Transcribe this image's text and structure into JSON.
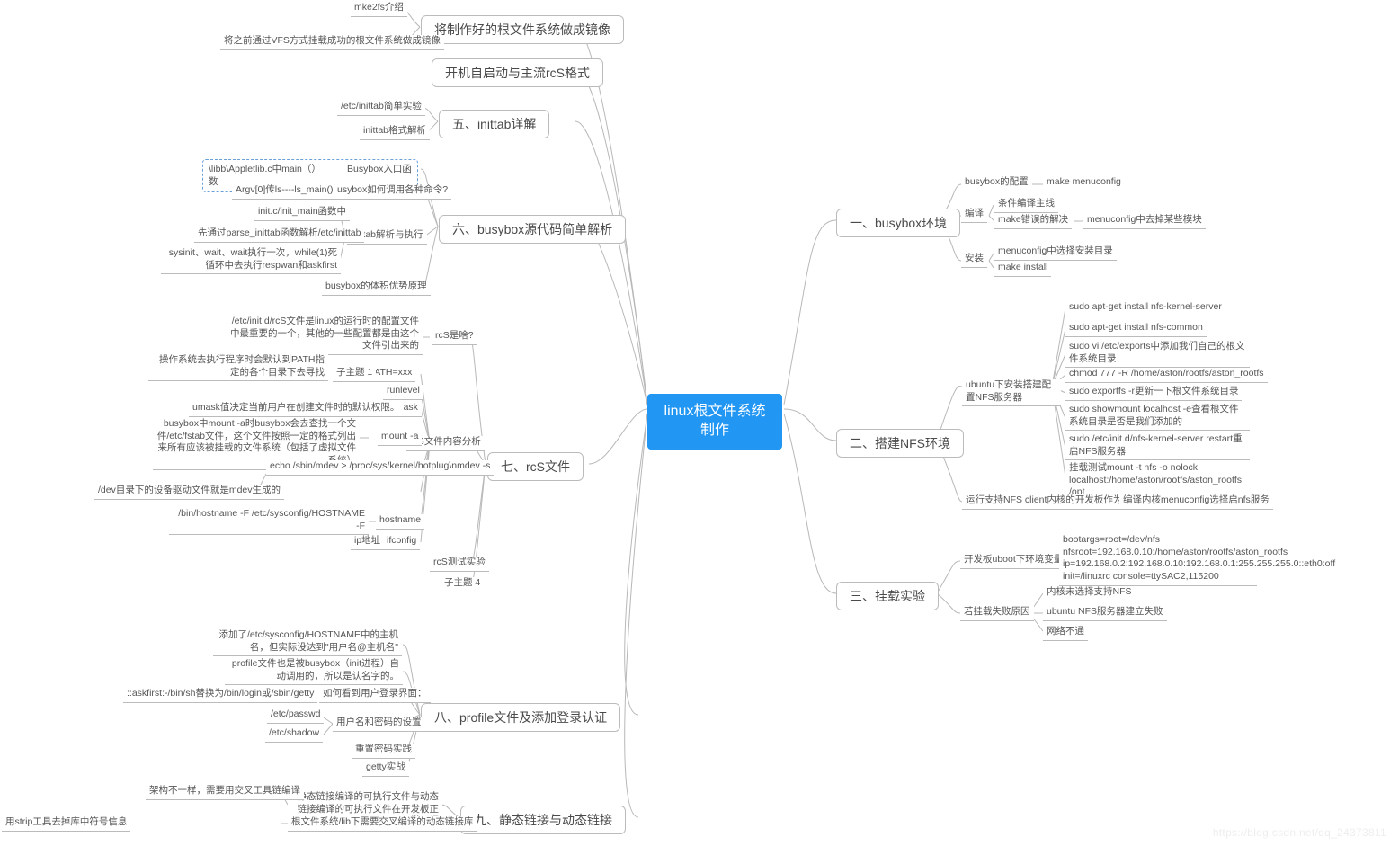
{
  "root": "linux根文件系统制作",
  "watermark": "https://blog.csdn.net/qq_24373811",
  "branches": {
    "b1": "一、busybox环境",
    "b2": "二、搭建NFS环境",
    "b3": "三、挂载实验",
    "b4": "将制作好的根文件系统做成镜像",
    "b5": "开机自启动与主流rcS格式",
    "b6": "五、inittab详解",
    "b7": "六、busybox源代码简单解析",
    "b8": "七、rcS文件",
    "b9": "八、profile文件及添加登录认证",
    "b10": "九、静态链接与动态链接"
  },
  "r1": {
    "cfg": "busybox的配置",
    "cfg_d": "make menuconfig",
    "comp": "编译",
    "comp1": "条件编译主线",
    "comp2": "make错误的解决",
    "comp2d": "menuconfig中去掉某些模块",
    "inst": "安装",
    "inst1": "menuconfig中选择安装目录",
    "inst2": "make install"
  },
  "r2": {
    "a": "ubuntu下安装搭建配置NFS服务器",
    "a1": "sudo apt-get install nfs-kernel-server",
    "a2": "sudo apt-get install nfs-common",
    "a3": "sudo vi /etc/exports中添加我们自己的根文件系统目录",
    "a4": "chmod 777 -R /home/aston/rootfs/aston_rootfs",
    "a5": "sudo exportfs -r更新一下根文件系统目录",
    "a6": "sudo showmount localhost -e查看根文件系统目录是否是我们添加的",
    "a7": "sudo /etc/init.d/nfs-kernel-server restart重启NFS服务器",
    "a8": "挂载测试mount -t nfs -o nolock localhost:/home/aston/rootfs/aston_rootfs /opt",
    "b": "运行支持NFS client内核的开发板作为客户端",
    "b1": "编译内核menuconfig选择启nfs服务"
  },
  "r3": {
    "a": "开发板uboot下环境变量配置",
    "a1": "bootargs=root=/dev/nfs nfsroot=192.168.0.10:/home/aston/rootfs/aston_rootfs ip=192.168.0.2:192.168.0.10:192.168.0.1:255.255.255.0::eth0:off init=/linuxrc console=ttySAC2,115200",
    "b": "若挂载失败原因",
    "b1": "内核未选择支持NFS",
    "b2": "ubuntu NFS服务器建立失败",
    "b3": "网络不通"
  },
  "l4": {
    "a": "mke2fs介绍",
    "b": "将之前通过VFS方式挂载成功的根文件系统做成镜像"
  },
  "l6": {
    "a": "/etc/inittab简单实验",
    "b": "inittab格式解析"
  },
  "l7": {
    "a": "\\libb\\Appletlib.c中main（）          Busybox入口函数",
    "b": "Busybox如何调用各种命令?",
    "b1": "Argv[0]传ls----ls_main()",
    "c": "inittab解析与执行",
    "c1": "init.c/init_main函数中",
    "c2": "先通过parse_inittab函数解析/etc/inittab",
    "c3": "sysinit、wait、wait执行一次，while(1)死循环中去执行respwan和askfirst",
    "d": "busybox的体积优势原理"
  },
  "l8": {
    "a": "rcS是啥?",
    "a1": "/etc/init.d/rcS文件是linux的运行时的配置文件中最重要的一个，其他的一些配置都是由这个文件引出来的",
    "b": "rcS文件内容分析",
    "b1l": "PATH=xxx",
    "b1t": "子主题 1",
    "b1d": "操作系统去执行程序时会默认到PATH指定的各个目录下去寻找",
    "b2": "runlevel",
    "b3": "umask",
    "b3d": "umask值决定当前用户在创建文件时的默认权限。",
    "b4": "mount -a",
    "b4d": "busybox中mount -a时busybox会去查找一个文件/etc/fstab文件，这个文件按照一定的格式列出来所有应该被挂载的文件系统（包括了虚拟文件系统）",
    "b5": "echo /sbin/mdev > /proc/sys/kernel/hotplug\\nmdev -s",
    "b5d": "/dev目录下的设备驱动文件就是mdev生成的",
    "b6": "hostname",
    "b6d": "/bin/hostname -F /etc/sysconfig/HOSTNAME -F",
    "b7": "ifconfig",
    "b7d": "ip地址",
    "c": "rcS测试实验",
    "d": "子主题 4"
  },
  "l9": {
    "a": "添加了/etc/sysconfig/HOSTNAME中的主机名，但实际没达到\"用户名@主机名\"",
    "b": "profile文件也是被busybox（init进程）自动调用的，所以是认名字的。",
    "c": "如何看到用户登录界面：",
    "c1": "::askfirst:-/bin/sh替换为/bin/login或/sbin/getty",
    "d": "用户名和密码的设置",
    "d1": "/etc/passwd",
    "d2": "/etc/shadow",
    "e": "重置密码实践",
    "f": "getty实战"
  },
  "l10": {
    "a": "静态链接编译的可执行文件与动态链接编译的可执行文件在开发板正常运行",
    "a1": "架构不一样，需要用交叉工具链编译",
    "b": "根文件系统/lib下需要交叉编译的动态链接库",
    "b1": "用strip工具去掉库中符号信息"
  }
}
